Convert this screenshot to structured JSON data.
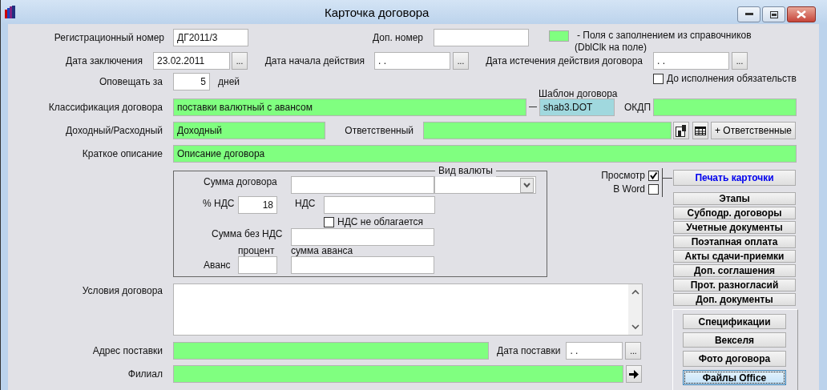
{
  "window": {
    "title": "Карточка договора"
  },
  "registration": {
    "label": "Регистрационный номер",
    "value": "ДГ2011/3"
  },
  "extra_number": {
    "label": "Доп. номер"
  },
  "legend": {
    "text": "- Поля с заполнением из справочников",
    "hint": "(DblClk на поле)"
  },
  "conclusion_date": {
    "label": "Дата заключения",
    "value": "23.02.2011",
    "button": "..."
  },
  "start_date": {
    "label": "Дата начала действия",
    "value": ". .",
    "button": "..."
  },
  "expiry_date": {
    "label": "Дата истечения действия договора",
    "value": ". .",
    "button": "..."
  },
  "notify": {
    "label": "Оповещать за",
    "value": "5",
    "unit": "дней"
  },
  "until_fulfilled": {
    "label": "До исполнения обязательств",
    "checked": false
  },
  "template": {
    "label": "Шаблон договора",
    "value": "shab3.DOT"
  },
  "classification": {
    "label": "Классификация договора",
    "value": "поставки валютный с авансом",
    "lookup": true
  },
  "okdp": {
    "label": "ОКДП",
    "lookup": true
  },
  "income_expense": {
    "label": "Доходный/Расходный",
    "value": "Доходный",
    "lookup": true
  },
  "responsible": {
    "label": "Ответственный",
    "lookup": true,
    "button": "+ Ответственные"
  },
  "summary": {
    "label": "Краткое описание",
    "value": "Описание договора",
    "lookup": true
  },
  "currency_group": {
    "title": "Вид валюты",
    "amount_label": "Сумма договора",
    "vat_rate_label": "% НДС",
    "vat_rate": "18",
    "vat_label": "НДС",
    "vat_exempt": {
      "label": "НДС не облагается",
      "checked": false
    },
    "net_label": "Сумма без НДС",
    "percent_label": "процент",
    "advance_sum_label": "сумма аванса",
    "advance_label": "Аванс"
  },
  "print": {
    "preview": {
      "label": "Просмотр",
      "checked": true
    },
    "word": {
      "label": "В Word",
      "checked": false
    },
    "button": "Печать карточки"
  },
  "section_buttons": [
    "Этапы",
    "Субподр. договоры",
    "Учетные документы",
    "Поэтапная оплата",
    "Акты сдачи-приемки",
    "Доп. соглашения",
    "Прот. разногласий",
    "Доп. документы"
  ],
  "terms": {
    "label": "Условия договора"
  },
  "delivery_address": {
    "label": "Адрес поставки",
    "lookup": true
  },
  "delivery_date": {
    "label": "Дата поставки",
    "value": ". .",
    "button": "..."
  },
  "branch": {
    "label": "Филиал",
    "lookup": true
  },
  "extra_buttons": [
    {
      "label": "Спецификации",
      "focused": false
    },
    {
      "label": "Векселя",
      "focused": false
    },
    {
      "label": "Фото договора",
      "focused": false
    },
    {
      "label": "Файлы Office",
      "focused": true
    }
  ]
}
